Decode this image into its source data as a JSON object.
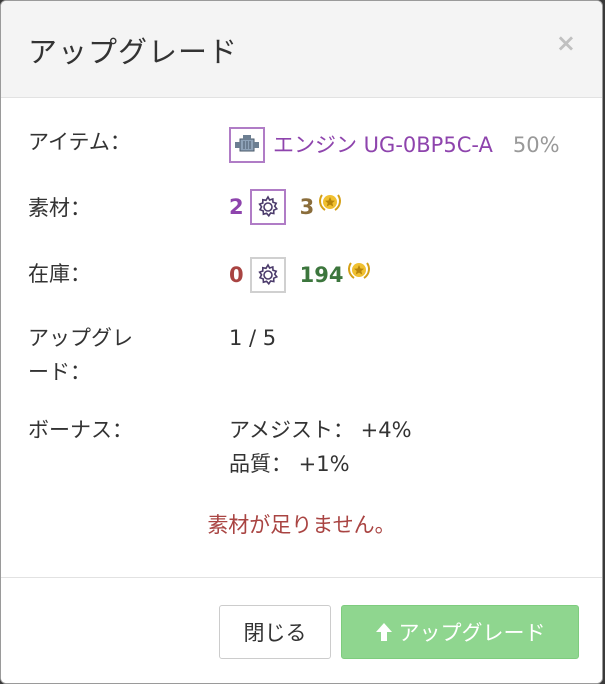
{
  "dialog": {
    "title": "アップグレード",
    "close_symbol": "×"
  },
  "rows": {
    "item": {
      "label": "アイテム：",
      "icon": "engine-icon",
      "name": "エンジン UG-0BP5C-A",
      "percent": "50%"
    },
    "material": {
      "label": "素材：",
      "gear_count": "2",
      "gear_icon": "gear-icon",
      "star_count": "3",
      "star_icon": "star-medal-icon"
    },
    "stock": {
      "label": "在庫：",
      "gear_count": "0",
      "gear_icon": "gear-icon",
      "star_count": "194",
      "star_icon": "star-medal-icon"
    },
    "upgrade": {
      "label_line1": "アップグレ",
      "label_line2": "ード：",
      "value": "1 / 5"
    },
    "bonus": {
      "label": "ボーナス：",
      "line1": "アメジスト： +4%",
      "line2": "品質： +1%"
    }
  },
  "error_message": "素材が足りません。",
  "footer": {
    "close_label": "閉じる",
    "upgrade_label": "アップグレード",
    "upgrade_icon": "arrow-up-icon"
  },
  "colors": {
    "purple": "#8e44ad",
    "red": "#a94442",
    "green": "#3c763d",
    "gold": "#d4a017",
    "upgrade_button": "#8fd68f"
  }
}
